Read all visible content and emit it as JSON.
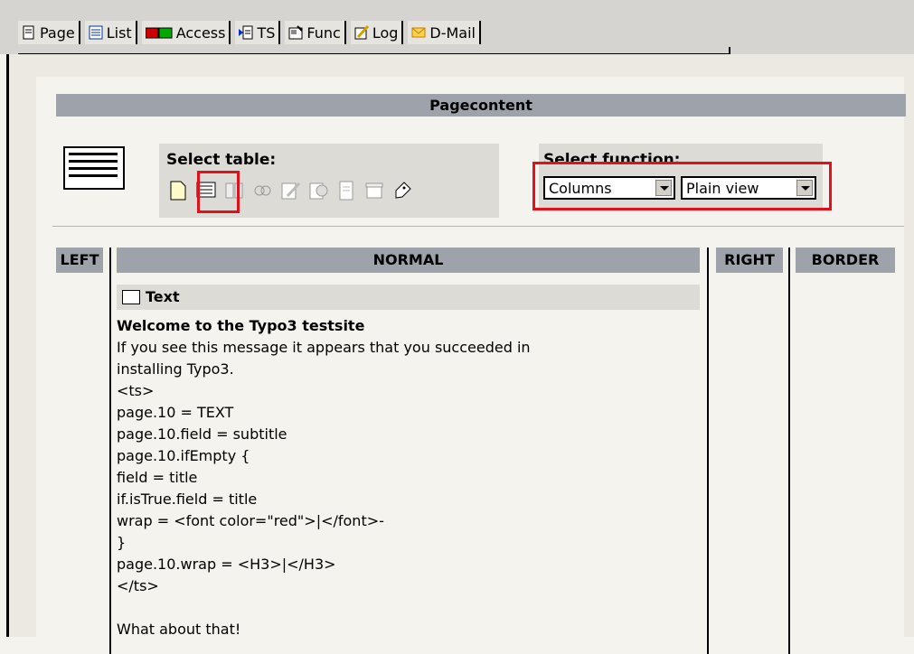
{
  "tabs": [
    {
      "label": "Page",
      "icon": "page-icon"
    },
    {
      "label": "List",
      "icon": "list-icon"
    },
    {
      "label": "Access",
      "icon": "access-icon"
    },
    {
      "label": "TS",
      "icon": "ts-icon"
    },
    {
      "label": "Func",
      "icon": "func-icon"
    },
    {
      "label": "Log",
      "icon": "log-icon"
    },
    {
      "label": "D-Mail",
      "icon": "mail-icon"
    }
  ],
  "header": {
    "title": "Pagecontent"
  },
  "select_table": {
    "label": "Select table:"
  },
  "select_function": {
    "label": "Select function:",
    "columns_value": "Columns",
    "view_value": "Plain view"
  },
  "columns": {
    "left": "LEFT",
    "normal": "NORMAL",
    "right": "RIGHT",
    "border": "BORDER"
  },
  "content_element": {
    "type_label": "Text",
    "lines": [
      "Welcome to the Typo3 testsite",
      "If you see this message it appears that you succeeded in",
      "installing Typo3.",
      "<ts>",
      "page.10 = TEXT",
      "page.10.field = subtitle",
      "page.10.ifEmpty {",
      "field = title",
      "if.isTrue.field = title",
      "wrap = <font color=\"red\">|</font>-",
      "}",
      "page.10.wrap = <H3>|</H3>",
      "</ts>",
      "",
      "What about that!"
    ]
  },
  "colors": {
    "header_bg": "#9ea3ab",
    "highlight": "#e2101a",
    "panel_bg": "#dcdbd5"
  }
}
